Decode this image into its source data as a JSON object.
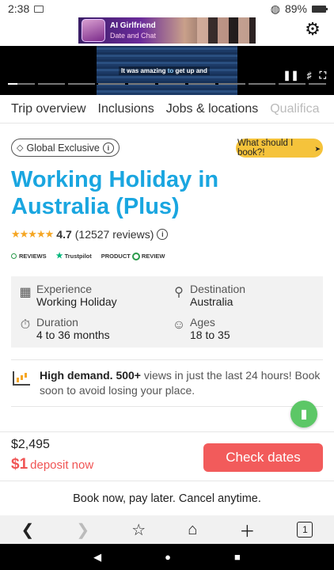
{
  "status": {
    "time": "2:38",
    "battery": "89%"
  },
  "ad": {
    "line1": "AI Girlfriend",
    "line2": "Date and Chat"
  },
  "video": {
    "caption_before": "It was amazing ",
    "caption_hl": "to",
    "caption_after": " get up and",
    "progress": 0.03
  },
  "tabs": [
    "Trip overview",
    "Inclusions",
    "Jobs & locations",
    "Qualifica"
  ],
  "badge": {
    "label": "Global Exclusive"
  },
  "book_pill": {
    "label": "What should I book?!"
  },
  "title": "Working Holiday in Australia (Plus)",
  "rating": {
    "score": "4.7",
    "count": "(12527 reviews)",
    "stars": 4.7
  },
  "review_logos": {
    "reviews": "REVIEWS",
    "trustpilot": "Trustpilot",
    "product": "PRODUCT",
    "review": "REVIEW"
  },
  "info": {
    "experience": {
      "label": "Experience",
      "value": "Working Holiday"
    },
    "destination": {
      "label": "Destination",
      "value": "Australia"
    },
    "duration": {
      "label": "Duration",
      "value": "4 to 36 months"
    },
    "ages": {
      "label": "Ages",
      "value": "18 to 35"
    }
  },
  "demand": {
    "strong": "High demand. 500+",
    "rest": " views in just the last 24 hours! Book soon to avoid losing your place."
  },
  "pricing": {
    "price": "$2,495",
    "deposit_amount": "$1",
    "deposit_text": "deposit now",
    "cta": "Check dates"
  },
  "book_now": "Book now, pay later. Cancel anytime.",
  "browser": {
    "tab_count": "1"
  },
  "colors": {
    "brand": "#1aa6e0",
    "cta": "#f25b5b",
    "pill": "#f5c33b",
    "chat": "#5cc766"
  }
}
